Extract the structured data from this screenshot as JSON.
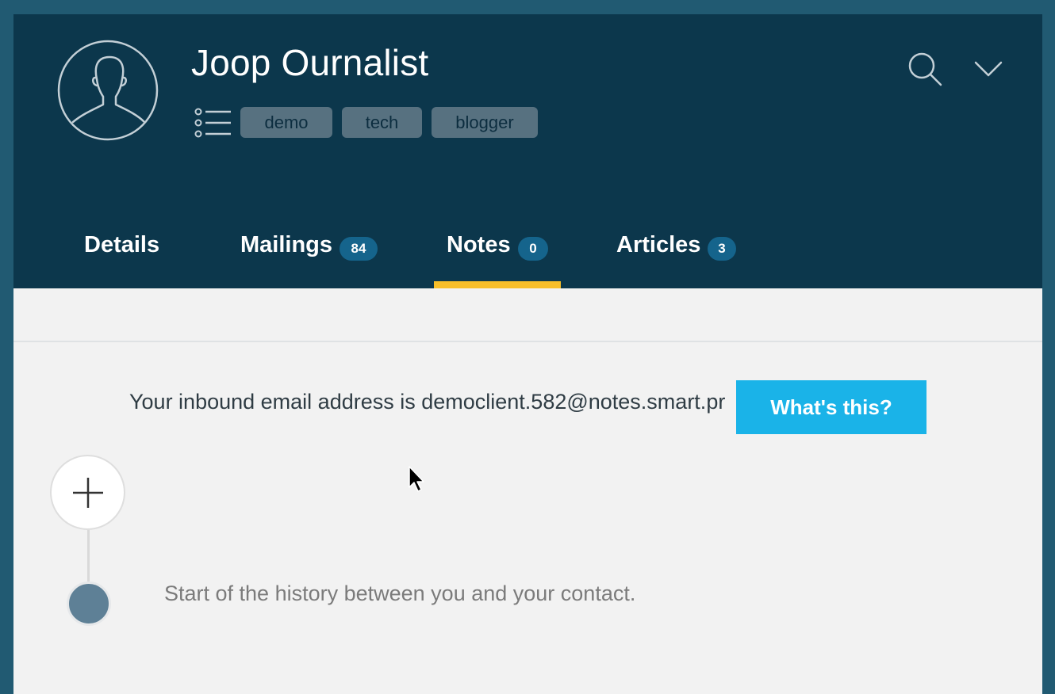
{
  "contact": {
    "name": "Joop Ournalist",
    "tags": [
      "demo",
      "tech",
      "blogger"
    ]
  },
  "header": {
    "search_icon": "search-icon",
    "menu_icon": "chevron-down-icon",
    "avatar_icon": "user-silhouette-icon",
    "tags_icon": "list-icon"
  },
  "tabs": [
    {
      "label": "Details",
      "count": null
    },
    {
      "label": "Mailings",
      "count": "84"
    },
    {
      "label": "Notes",
      "count": "0",
      "active": true
    },
    {
      "label": "Articles",
      "count": "3"
    }
  ],
  "notes": {
    "inbound_text": "Your inbound email address is democlient.582@notes.smart.pr",
    "whats_this_label": "What's this?",
    "add_note_icon": "plus-icon",
    "history_start_text": "Start of the history between you and your contact."
  },
  "colors": {
    "header_bg": "#0c374c",
    "accent_underline": "#f7be29",
    "button_blue": "#1ab3e8",
    "badge_blue": "#15648c"
  }
}
